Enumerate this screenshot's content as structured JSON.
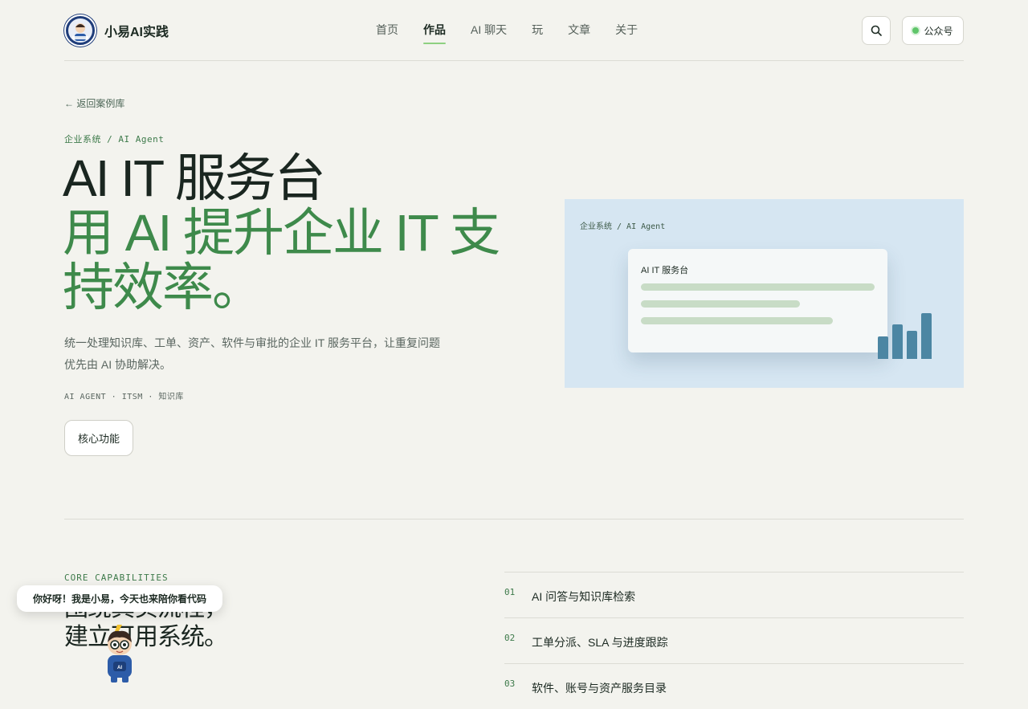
{
  "header": {
    "logo_text": "小易AI实践",
    "nav": [
      {
        "label": "首页",
        "active": false
      },
      {
        "label": "作品",
        "active": true
      },
      {
        "label": "AI 聊天",
        "active": false
      },
      {
        "label": "玩",
        "active": false
      },
      {
        "label": "文章",
        "active": false
      },
      {
        "label": "关于",
        "active": false
      }
    ],
    "search_icon": "search-icon",
    "gzh_label": "公众号"
  },
  "hero": {
    "back_link": "← 返回案例库",
    "breadcrumb": "企业系统 / AI Agent",
    "title_line1": "AI IT 服务台",
    "title_line2": "用 AI 提升企业 IT 支持效率。",
    "description": "统一处理知识库、工单、资产、软件与审批的企业 IT 服务平台，让重复问题优先由 AI 协助解决。",
    "tags": "AI AGENT · ITSM · 知识库",
    "core_button": "核心功能"
  },
  "preview": {
    "breadcrumb": "企业系统 / AI Agent",
    "card_title": "AI IT 服务台"
  },
  "capabilities": {
    "label": "CORE CAPABILITIES",
    "title_line1": "围绕真实流程，",
    "title_line2": "建立可用系统。",
    "items": [
      {
        "num": "01",
        "text": "AI 问答与知识库检索"
      },
      {
        "num": "02",
        "text": "工单分派、SLA 与进度跟踪"
      },
      {
        "num": "03",
        "text": "软件、账号与资产服务目录"
      }
    ]
  },
  "mascot": {
    "bubble": "你好呀！我是小易，今天也来陪你看代码",
    "badge": "AI"
  },
  "colors": {
    "background": "#f3f3ee",
    "accent_green": "#3e8a4b",
    "nav_underline": "#8ed081",
    "preview_bg": "#d6e6f2",
    "bar_blue": "#4c86a3"
  }
}
